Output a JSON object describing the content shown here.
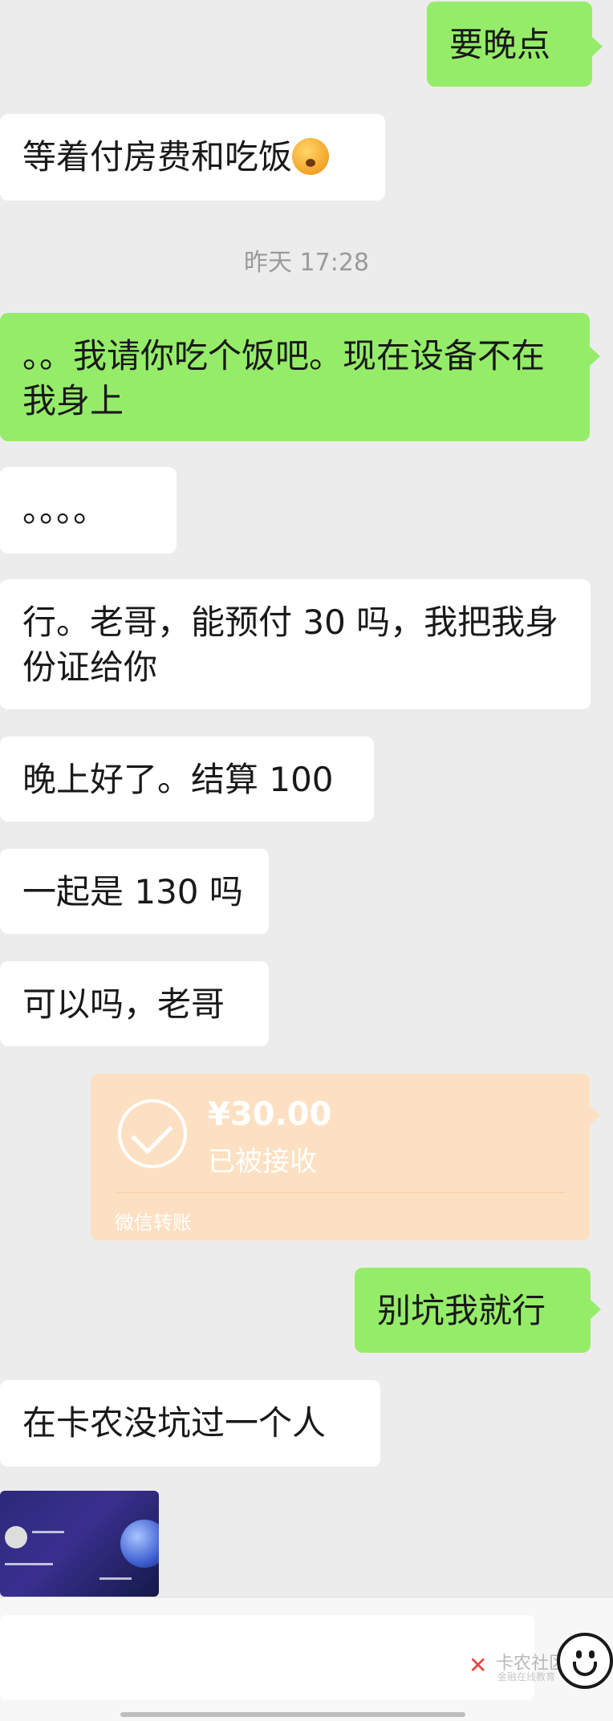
{
  "messages": [
    {
      "side": "right",
      "text": "要晚点"
    },
    {
      "side": "left",
      "text": "等着付房费和吃饭"
    },
    {
      "side": "right",
      "text": "。。我请你吃个饭吧。现在设备不在我身上"
    },
    {
      "side": "left",
      "text": "。。。。"
    },
    {
      "side": "left",
      "text": "行。老哥，能预付 30 吗，我把我身份证给你"
    },
    {
      "side": "left",
      "text": "晚上好了。结算 100"
    },
    {
      "side": "left",
      "text": "一起是 130 吗"
    },
    {
      "side": "left",
      "text": "可以吗，老哥"
    },
    {
      "side": "right",
      "text": "别坑我就行"
    },
    {
      "side": "left",
      "text": "在卡农没坑过一个人"
    }
  ],
  "timestamp": "昨天 17:28",
  "transfer": {
    "amount": "¥30.00",
    "status": "已被接收",
    "label": "微信转账",
    "color": "#fde0c2"
  },
  "watermark": {
    "name": "卡农社区",
    "sub": "金融在线教育"
  },
  "icons": {
    "emoji_button": "emoji-face-icon",
    "sticker": "thinking-face-emoji"
  },
  "colors": {
    "right_bubble": "#95ec69",
    "left_bubble": "#ffffff",
    "background": "#ececec"
  }
}
